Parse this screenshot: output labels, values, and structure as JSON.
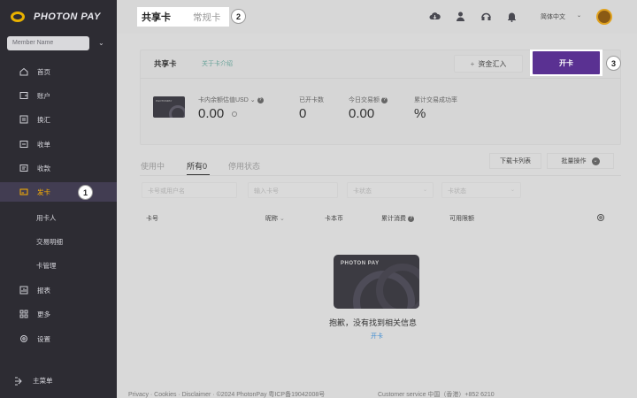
{
  "brand": {
    "name": "PHOTON PAY",
    "logo_color": "#e8b100"
  },
  "member": {
    "placeholder": "Member Name"
  },
  "sidebar": {
    "items": [
      {
        "label": "首页",
        "icon": "home-icon"
      },
      {
        "label": "账户",
        "icon": "account-icon"
      },
      {
        "label": "换汇",
        "icon": "exchange-icon"
      },
      {
        "label": "收单",
        "icon": "acquiring-icon"
      },
      {
        "label": "收款",
        "icon": "receive-icon"
      },
      {
        "label": "发卡",
        "icon": "card-icon",
        "active": true
      },
      {
        "label": "用卡人",
        "sub": true
      },
      {
        "label": "交易明细",
        "sub": true
      },
      {
        "label": "卡管理",
        "sub": true
      },
      {
        "label": "报表",
        "icon": "report-icon"
      },
      {
        "label": "更多",
        "icon": "more-icon"
      },
      {
        "label": "设置",
        "icon": "settings-icon"
      }
    ],
    "collapse_label": "主菜单"
  },
  "markers": {
    "one": "1",
    "two": "2",
    "three": "3"
  },
  "topbar": {
    "tabs": [
      {
        "label": "共享卡"
      },
      {
        "label": "常规卡"
      }
    ],
    "language": "简体中文"
  },
  "panel": {
    "title": "共享卡",
    "link": "关于卡介绍",
    "fund_button": "资金汇入",
    "open_button": "开卡",
    "card_brand": "PHOTONPAY",
    "stats": [
      {
        "label": "卡内余额估值USD",
        "value": "0.00"
      },
      {
        "label": "已开卡数",
        "value": "0"
      },
      {
        "label": "今日交易额",
        "value": "0.00"
      },
      {
        "label": "累计交易成功率",
        "value": "%"
      }
    ]
  },
  "list": {
    "tabs": [
      {
        "label": "使用中"
      },
      {
        "label": "所有0"
      },
      {
        "label": "停用状态"
      }
    ],
    "download_button": "下载卡列表",
    "batch_button": "批量操作",
    "filters": [
      "卡号或用户名",
      "输入卡号",
      "卡状态",
      "卡状态"
    ],
    "columns": [
      "卡号",
      "昵称",
      "卡本币",
      "累计消费",
      "可用限额"
    ],
    "empty_text": "抱歉，没有找到相关信息",
    "empty_link": "开卡"
  },
  "footer": {
    "left": "Privacy · Cookies · Disclaimer · ©2024 PhotonPay 粤ICP备19042008号",
    "right": "Customer service 中国（香港）+852 6210"
  }
}
